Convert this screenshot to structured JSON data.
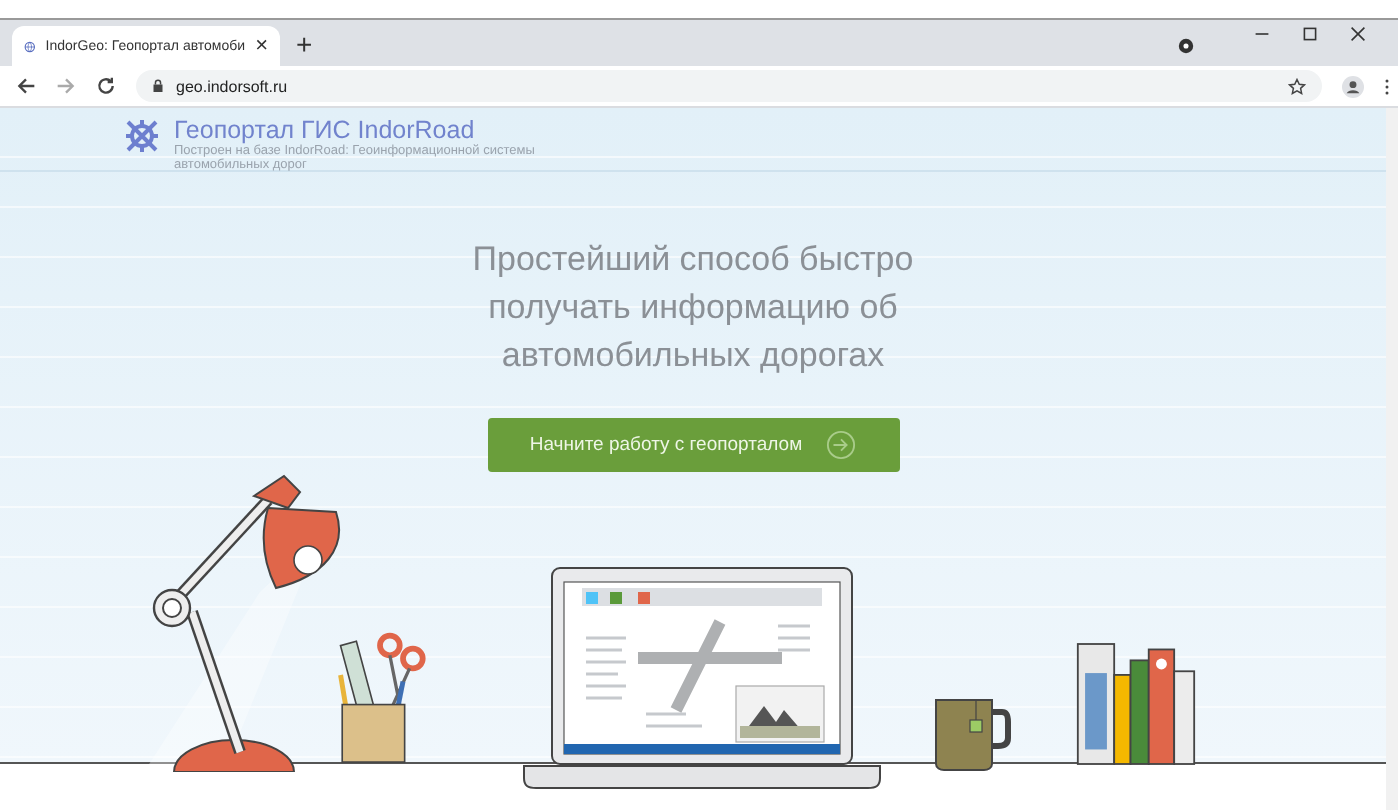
{
  "browser": {
    "tab": {
      "title": "IndorGeo: Геопортал автомоби",
      "close": "×",
      "selected": true
    },
    "new_tab": "+",
    "url": "geo.indorsoft.ru"
  },
  "header": {
    "title": "Геопортал ГИС IndorRoad",
    "subtitle": "Построен на базе IndorRoad: Геоинформационной системы автомобильных дорог"
  },
  "hero": {
    "headline": "Простейший способ быстро получать информацию об автомобильных дорогах",
    "button": "Начните работу с геопорталом"
  }
}
